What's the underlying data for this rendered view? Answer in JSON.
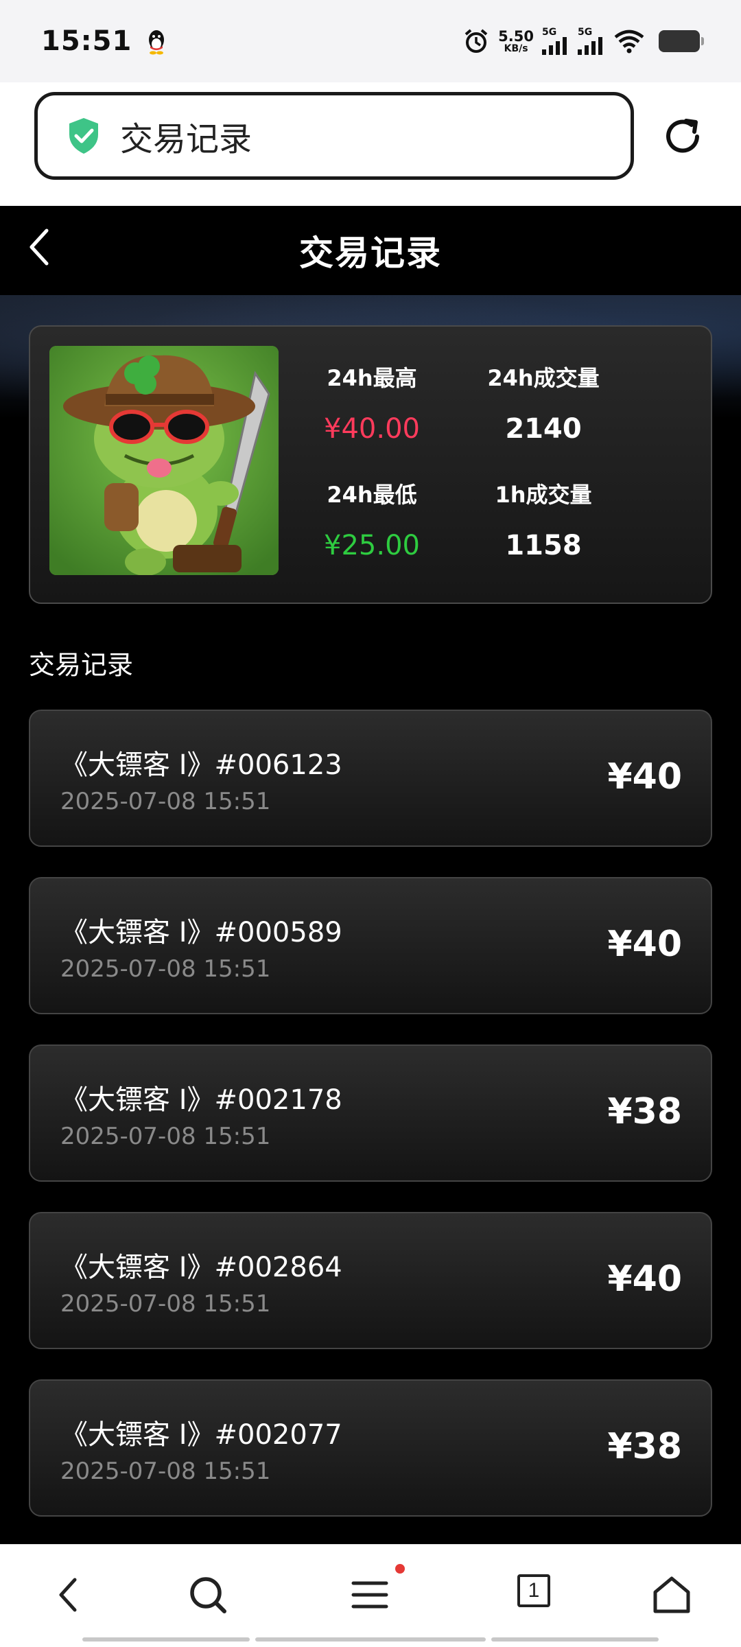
{
  "status_bar": {
    "time": "15:51",
    "net_speed_value": "5.50",
    "net_speed_unit": "KB/s",
    "sim1_label": "5G",
    "sim2_label": "5G",
    "icons": [
      "qq-icon",
      "alarm-icon",
      "signal-icon",
      "signal-icon",
      "wifi-icon",
      "battery-icon"
    ]
  },
  "browser": {
    "url_text": "交易记录",
    "icons": [
      "shield-check-icon",
      "refresh-icon"
    ]
  },
  "header": {
    "title": "交易记录"
  },
  "summary": {
    "high_label": "24h最高",
    "high_value": "¥40.00",
    "volume24_label": "24h成交量",
    "volume24_value": "2140",
    "low_label": "24h最低",
    "low_value": "¥25.00",
    "volume1_label": "1h成交量",
    "volume1_value": "1158",
    "high_color": "#ff3b5c",
    "low_color": "#2ecc40"
  },
  "section_label": "交易记录",
  "records": [
    {
      "name": "《大镖客 I》#006123",
      "time": "2025-07-08 15:51",
      "price": "¥40"
    },
    {
      "name": "《大镖客 I》#000589",
      "time": "2025-07-08 15:51",
      "price": "¥40"
    },
    {
      "name": "《大镖客 I》#002178",
      "time": "2025-07-08 15:51",
      "price": "¥38"
    },
    {
      "name": "《大镖客 I》#002864",
      "time": "2025-07-08 15:51",
      "price": "¥40"
    },
    {
      "name": "《大镖客 I》#002077",
      "time": "2025-07-08 15:51",
      "price": "¥38"
    }
  ],
  "bottom_nav": {
    "tab_count": "1",
    "icons": [
      "back-icon",
      "search-icon",
      "menu-icon",
      "tabs-icon",
      "home-icon"
    ]
  }
}
